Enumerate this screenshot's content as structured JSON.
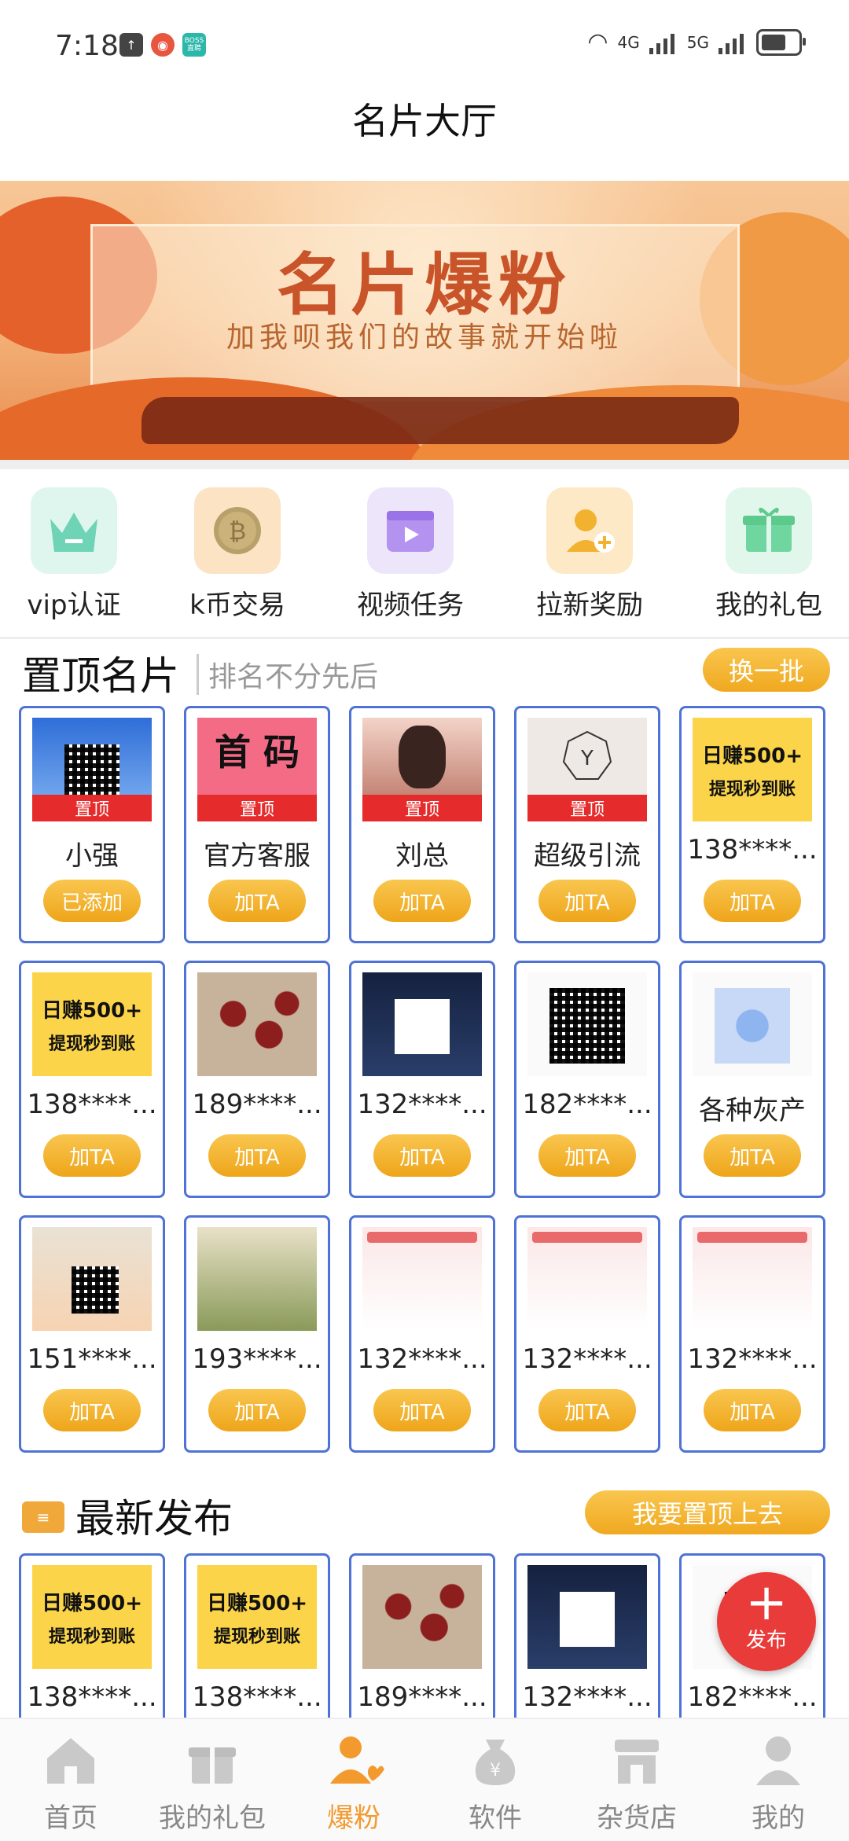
{
  "status_bar": {
    "time": "7:18",
    "app_badge": "BOSS直聘",
    "network1": "4G",
    "network2": "5G"
  },
  "header": {
    "title": "名片大厅"
  },
  "banner": {
    "title": "名片爆粉",
    "subtitle": "加我呗我们的故事就开始啦"
  },
  "quick_actions": [
    {
      "label": "vip认证",
      "icon": "crown-icon"
    },
    {
      "label": "k币交易",
      "icon": "coin-icon"
    },
    {
      "label": "视频任务",
      "icon": "video-icon"
    },
    {
      "label": "拉新奖励",
      "icon": "add-user-icon"
    },
    {
      "label": "我的礼包",
      "icon": "gift-icon"
    }
  ],
  "pinned": {
    "title": "置顶名片",
    "subtitle": "排名不分先后",
    "refresh_label": "换一批",
    "pinned_tag": "置顶",
    "cards": [
      {
        "name": "小强",
        "button": "已添加",
        "pinned": true
      },
      {
        "name": "官方客服",
        "button": "加TA",
        "pinned": true
      },
      {
        "name": "刘总",
        "button": "加TA",
        "pinned": true
      },
      {
        "name": "超级引流",
        "button": "加TA",
        "pinned": true
      },
      {
        "name": "138****...",
        "button": "加TA",
        "pinned": false
      },
      {
        "name": "138****...",
        "button": "加TA",
        "pinned": false
      },
      {
        "name": "189****...",
        "button": "加TA",
        "pinned": false
      },
      {
        "name": "132****...",
        "button": "加TA",
        "pinned": false
      },
      {
        "name": "182****...",
        "button": "加TA",
        "pinned": false
      },
      {
        "name": "各种灰产",
        "button": "加TA",
        "pinned": false
      },
      {
        "name": "151****...",
        "button": "加TA",
        "pinned": false
      },
      {
        "name": "193****...",
        "button": "加TA",
        "pinned": false
      },
      {
        "name": "132****...",
        "button": "加TA",
        "pinned": false
      },
      {
        "name": "132****...",
        "button": "加TA",
        "pinned": false
      },
      {
        "name": "132****...",
        "button": "加TA",
        "pinned": false
      }
    ]
  },
  "promo_text": {
    "line1": "日赚500+",
    "line2": "提现秒到账"
  },
  "latest": {
    "title": "最新发布",
    "promote_label": "我要置顶上去",
    "cards": [
      {
        "name": "138****..."
      },
      {
        "name": "138****..."
      },
      {
        "name": "189****..."
      },
      {
        "name": "132****..."
      },
      {
        "name": "182****..."
      }
    ]
  },
  "fab": {
    "label": "发布"
  },
  "bottom_nav": [
    {
      "label": "首页",
      "icon": "home-icon",
      "active": false
    },
    {
      "label": "我的礼包",
      "icon": "gift-icon",
      "active": false
    },
    {
      "label": "爆粉",
      "icon": "fans-icon",
      "active": true
    },
    {
      "label": "软件",
      "icon": "money-bag-icon",
      "active": false
    },
    {
      "label": "杂货店",
      "icon": "store-icon",
      "active": false
    },
    {
      "label": "我的",
      "icon": "user-icon",
      "active": false
    }
  ],
  "colors": {
    "accent": "#f0a81f",
    "card_border": "#4f72d6",
    "pinned_tag": "#e52b2b",
    "fab": "#ea3b3b",
    "active_nav": "#f29a2e"
  }
}
